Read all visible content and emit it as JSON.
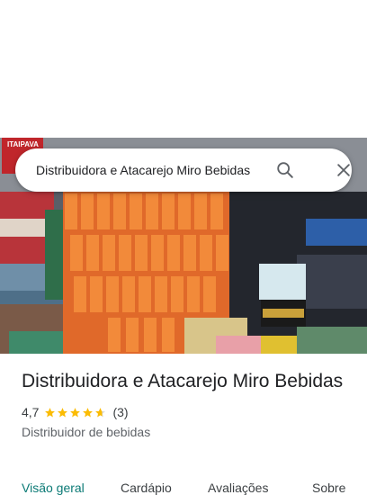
{
  "search": {
    "query": "Distribuidora e Atacarejo Miro Bebidas",
    "search_icon": "search-icon",
    "close_icon": "close-icon"
  },
  "place": {
    "name": "Distribuidora e Atacarejo Miro Bebidas",
    "rating": "4,7",
    "rating_value": 4.7,
    "review_count": "(3)",
    "category": "Distribuidor de bebidas"
  },
  "photo": {
    "description_icon": "store-photo",
    "sign_text": "ITAIPAVA"
  },
  "tabs": [
    {
      "label": "Visão geral",
      "active": true
    },
    {
      "label": "Cardápio",
      "active": false
    },
    {
      "label": "Avaliações",
      "active": false
    },
    {
      "label": "Sobre",
      "active": false
    }
  ],
  "colors": {
    "star": "#fbbc04",
    "active_tab": "#0b7a75",
    "text_primary": "#202124",
    "text_secondary": "#5f6368"
  }
}
